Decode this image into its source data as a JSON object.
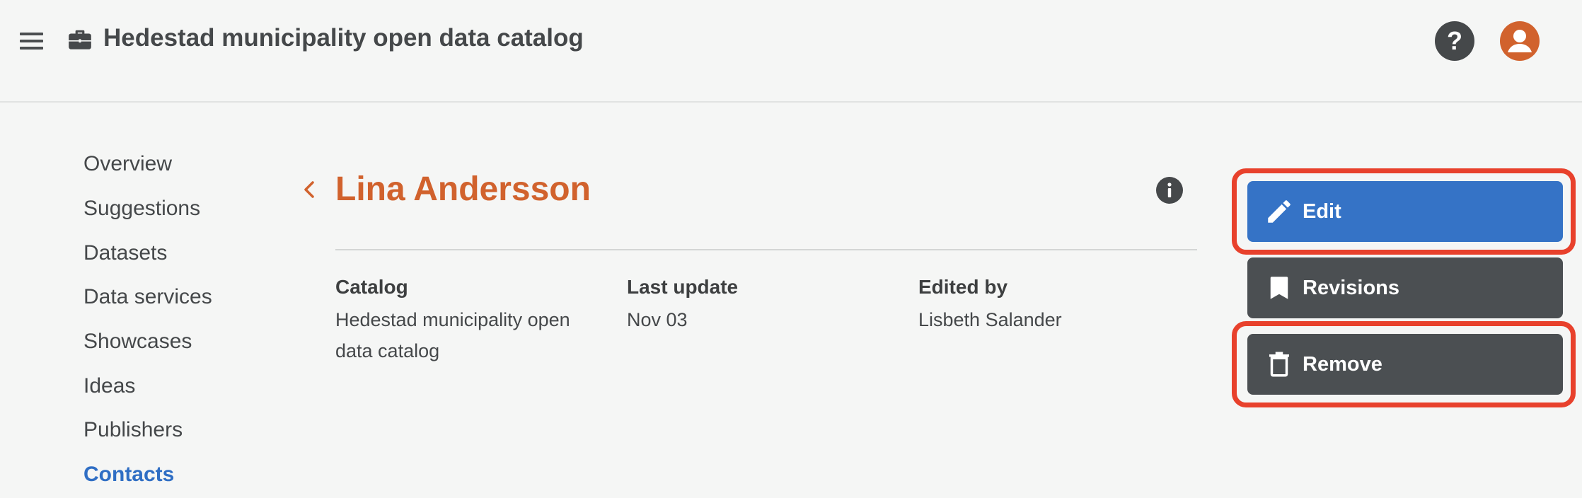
{
  "header": {
    "menu_icon": "hamburger-menu-icon",
    "catalog_icon": "briefcase-icon",
    "title": "Hedestad municipality open data catalog",
    "help_icon": "help-question-icon",
    "avatar_icon": "user-avatar-icon"
  },
  "sidenav": {
    "items": [
      {
        "label": "Overview"
      },
      {
        "label": "Suggestions"
      },
      {
        "label": "Datasets"
      },
      {
        "label": "Data services"
      },
      {
        "label": "Showcases"
      },
      {
        "label": "Ideas"
      },
      {
        "label": "Publishers"
      },
      {
        "label": "Contacts"
      }
    ],
    "active": "Contacts"
  },
  "contact": {
    "name": "Lina Andersson",
    "back_icon": "chevron-left-icon",
    "info_icon": "info-icon"
  },
  "meta": {
    "catalog": {
      "label": "Catalog",
      "value": "Hedestad municipality open data catalog"
    },
    "last_update": {
      "label": "Last update",
      "value": "Nov 03"
    },
    "edited_by": {
      "label": "Edited by",
      "value": "Lisbeth Salander"
    }
  },
  "actions": {
    "edit": {
      "label": "Edit",
      "icon": "pencil-icon"
    },
    "revisions": {
      "label": "Revisions",
      "icon": "bookmark-icon"
    },
    "remove": {
      "label": "Remove",
      "icon": "trash-icon"
    }
  },
  "colors": {
    "accent": "#d1622d",
    "primary_button": "#3573c6",
    "secondary_button": "#4b4f52",
    "active_nav": "#2f6ec4",
    "highlight": "#e8412c",
    "background": "#f5f6f5"
  }
}
